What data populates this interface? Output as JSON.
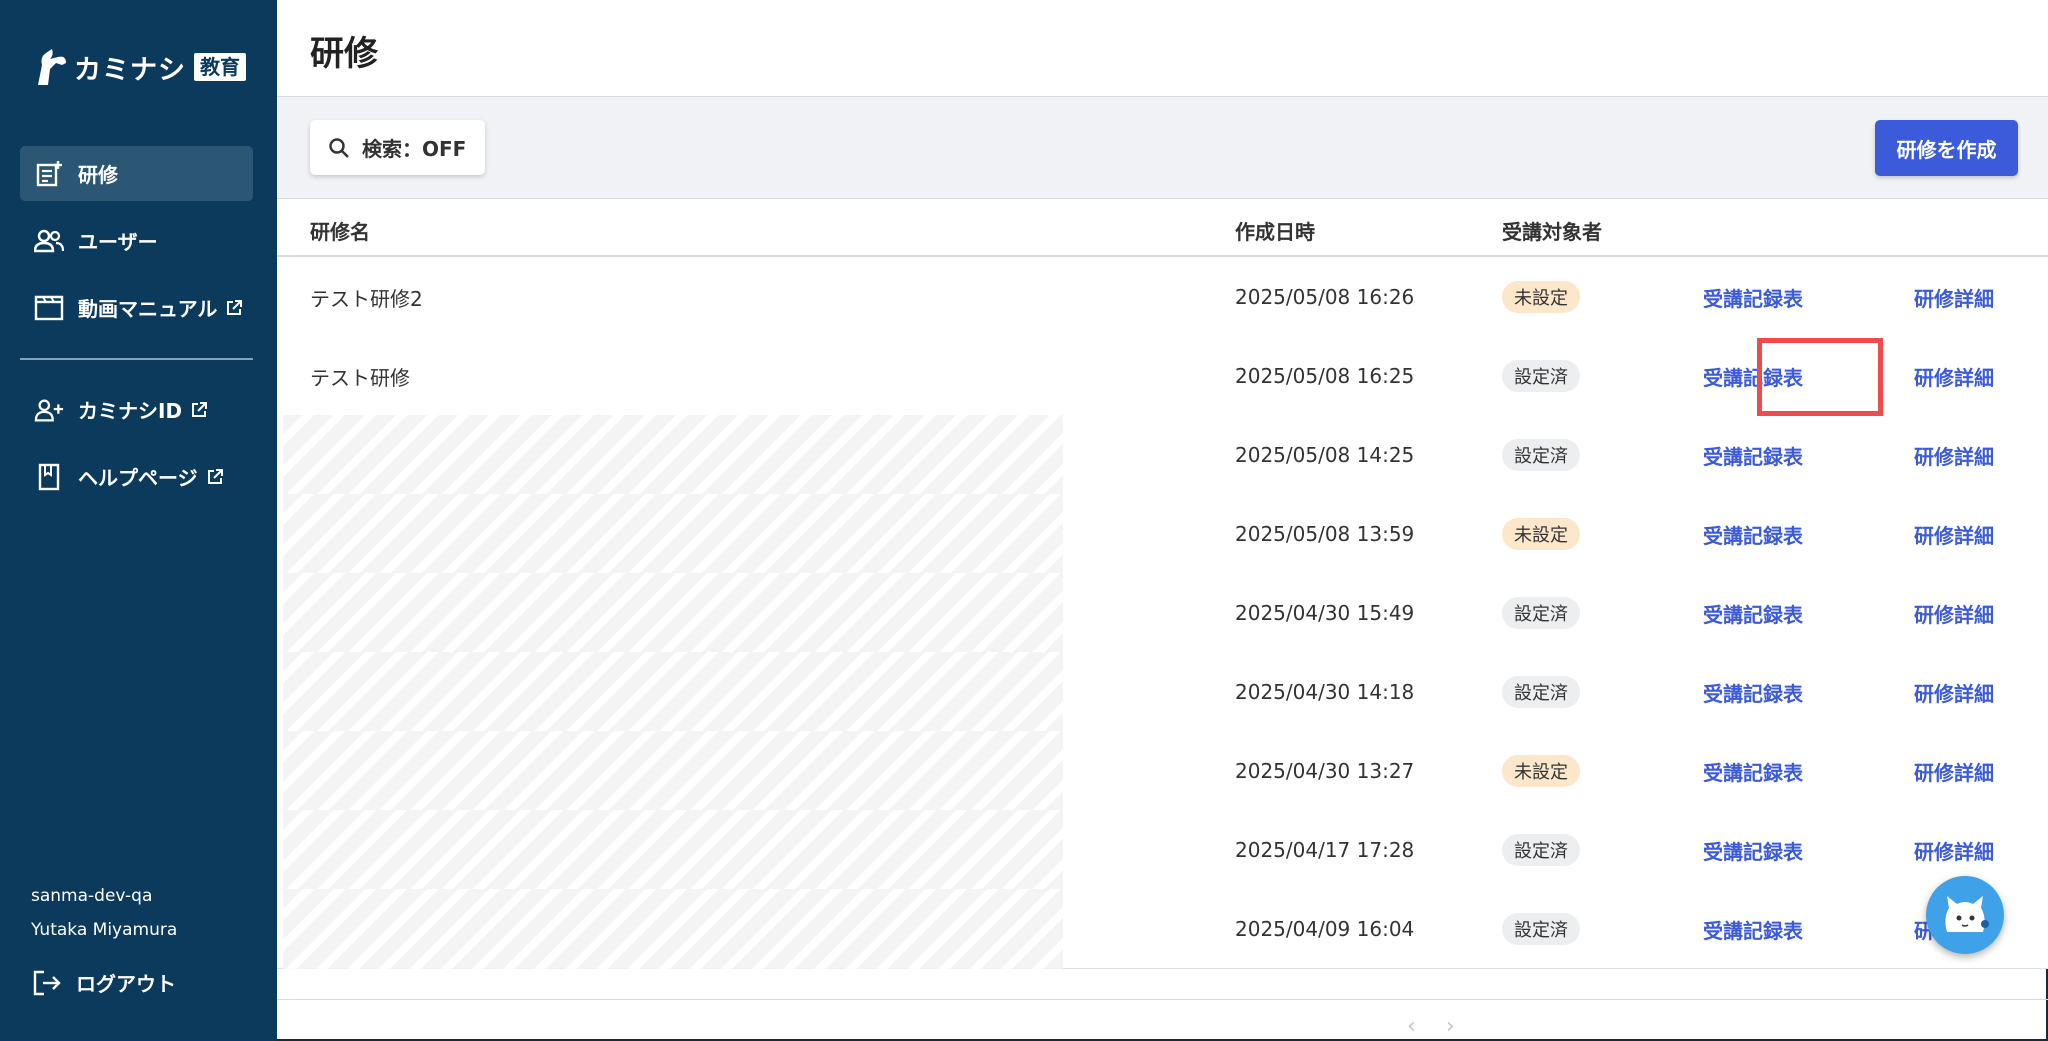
{
  "sidebar": {
    "logo_text": "カミナシ",
    "logo_badge": "教育",
    "nav": [
      {
        "label": "研修",
        "active": true
      },
      {
        "label": "ユーザー",
        "active": false
      },
      {
        "label": "動画マニュアル",
        "active": false,
        "external": true
      },
      {
        "label": "カミナシID",
        "active": false,
        "external": true
      },
      {
        "label": "ヘルプページ",
        "active": false,
        "external": true
      }
    ],
    "account_org": "sanma-dev-qa",
    "account_user": "Yutaka Miyamura",
    "logout_label": "ログアウト"
  },
  "header": {
    "title": "研修"
  },
  "toolbar": {
    "search_label": "検索：OFF",
    "create_label": "研修を作成"
  },
  "table": {
    "columns": [
      "研修名",
      "作成日時",
      "受講対象者"
    ],
    "rows": [
      {
        "name": "テスト研修2",
        "date": "2025/05/08 16:26",
        "status": "未設定",
        "record": "受講記録表",
        "detail": "研修詳細"
      },
      {
        "name": "テスト研修",
        "date": "2025/05/08 16:25",
        "status": "設定済",
        "record": "受講記録表",
        "detail": "研修詳細"
      },
      {
        "name": "",
        "date": "2025/05/08 14:25",
        "status": "設定済",
        "record": "受講記録表",
        "detail": "研修詳細"
      },
      {
        "name": "",
        "date": "2025/05/08 13:59",
        "status": "未設定",
        "record": "受講記録表",
        "detail": "研修詳細"
      },
      {
        "name": "",
        "date": "2025/04/30 15:49",
        "status": "設定済",
        "record": "受講記録表",
        "detail": "研修詳細"
      },
      {
        "name": "",
        "date": "2025/04/30 14:18",
        "status": "設定済",
        "record": "受講記録表",
        "detail": "研修詳細"
      },
      {
        "name": "",
        "date": "2025/04/30 13:27",
        "status": "未設定",
        "record": "受講記録表",
        "detail": "研修詳細"
      },
      {
        "name": "",
        "date": "2025/04/17 17:28",
        "status": "設定済",
        "record": "受講記録表",
        "detail": "研修詳細"
      },
      {
        "name": "",
        "date": "2025/04/09 16:04",
        "status": "設定済",
        "record": "受講記録表",
        "detail": "研"
      }
    ]
  },
  "pager": {
    "prev": "‹",
    "next": "›"
  },
  "colors": {
    "sidebar_bg": "#0c3a5c",
    "accent": "#3b5bdb",
    "unset_badge": "#fde7cb",
    "set_badge": "#eceeef",
    "highlight": "#ef4b4b"
  }
}
